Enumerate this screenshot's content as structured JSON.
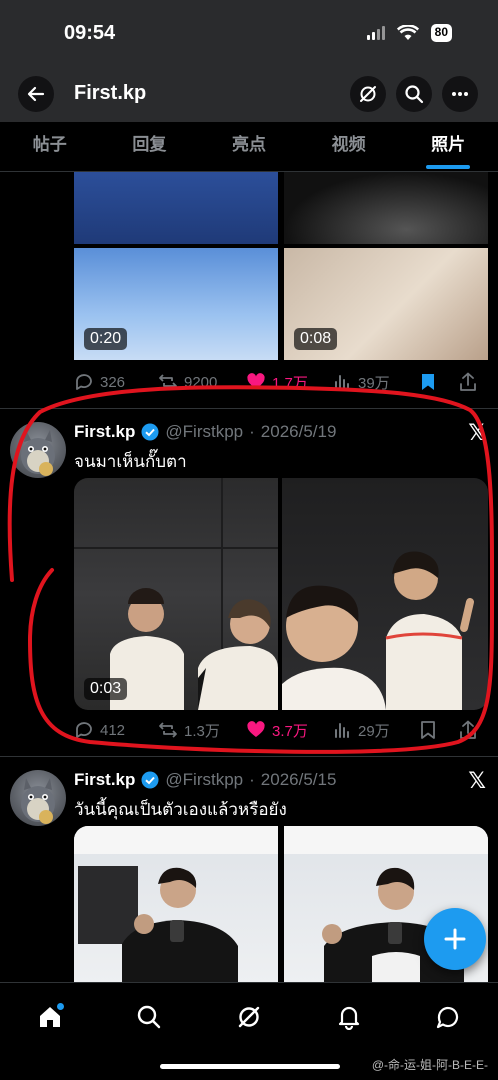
{
  "status": {
    "time": "09:54",
    "battery": "80"
  },
  "header": {
    "title": "First.kp"
  },
  "tabs": [
    {
      "label": "帖子"
    },
    {
      "label": "回复"
    },
    {
      "label": "亮点"
    },
    {
      "label": "视频"
    },
    {
      "label": "照片",
      "active": true
    }
  ],
  "post1": {
    "durations": [
      "0:20",
      "0:08"
    ],
    "stats": {
      "replies": "326",
      "reposts": "9200",
      "likes": "1.7万",
      "views": "39万"
    }
  },
  "post2": {
    "name": "First.kp",
    "handle": "@Firstkpp",
    "sep": "·",
    "date": "2026/5/19",
    "text": "จนมาเห็นกั๊บตา",
    "duration": "0:03",
    "stats": {
      "replies": "412",
      "reposts": "1.3万",
      "likes": "3.7万",
      "views": "29万"
    }
  },
  "post3": {
    "name": "First.kp",
    "handle": "@Firstkpp",
    "sep": "·",
    "date": "2026/5/15",
    "text": "วันนี้คุณเป็นตัวเองแล้วหรือยัง"
  },
  "watermark": "@-命-运-姐-阿-B-E-E-",
  "colors": {
    "accent": "#1d9bf0",
    "like": "#f91880",
    "annotation": "#e0141e"
  }
}
